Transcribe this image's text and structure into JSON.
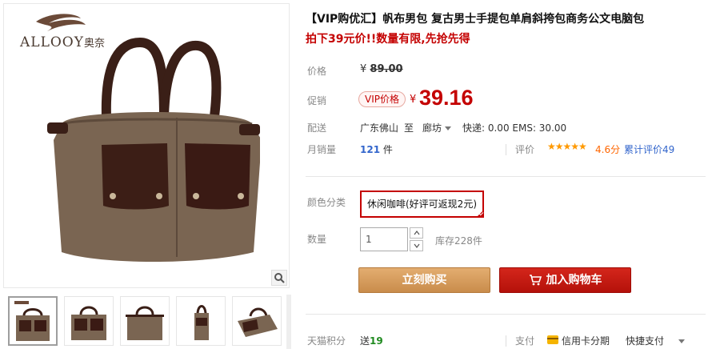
{
  "brand": {
    "logo_text": "ALLOOY",
    "logo_text_cn": "奥奈"
  },
  "gallery": {
    "thumbnails": [
      {
        "icon": "bag-front-with-logo",
        "active": true
      },
      {
        "icon": "bag-front",
        "active": false
      },
      {
        "icon": "bag-back",
        "active": false
      },
      {
        "icon": "bag-side",
        "active": false
      },
      {
        "icon": "bag-angle",
        "active": false
      }
    ]
  },
  "product": {
    "title": "【VIP购优汇】帆布男包 复古男士手提包单肩斜挎包商务公文电脑包",
    "promo_line": "拍下39元价!!数量有限,先抢先得"
  },
  "price": {
    "label": "价格",
    "currency": "¥",
    "original": "89.00"
  },
  "promo": {
    "label": "促销",
    "badge": "VIP价格",
    "currency": "¥",
    "price": "39.16"
  },
  "shipping": {
    "label": "配送",
    "from": "广东佛山",
    "to_word": "至",
    "destination": "廊坊",
    "fees": "快递: 0.00 EMS: 30.00"
  },
  "sales": {
    "label": "月销量",
    "count": "121",
    "unit": "件"
  },
  "rating": {
    "label": "评价",
    "stars": "★★★★★",
    "value": "4.6分",
    "review_link": "累计评价49"
  },
  "sku": {
    "label": "颜色分类",
    "selected": "休闲咖啡(好评可返现2元)"
  },
  "quantity": {
    "label": "数量",
    "value": "1",
    "stock": "库存228件"
  },
  "buttons": {
    "buy_now": "立刻购买",
    "add_to_cart": "加入购物车"
  },
  "footer": {
    "points_label": "天猫积分",
    "points_prefix": "送",
    "points_value": "19",
    "pay_label": "支付",
    "pay_credit": "信用卡分期",
    "pay_quick": "快捷支付"
  },
  "colors": {
    "accent_red": "#c40000",
    "buy_orange": "#d6a062",
    "link_blue": "#3366cc",
    "star_orange": "#ff9900"
  }
}
